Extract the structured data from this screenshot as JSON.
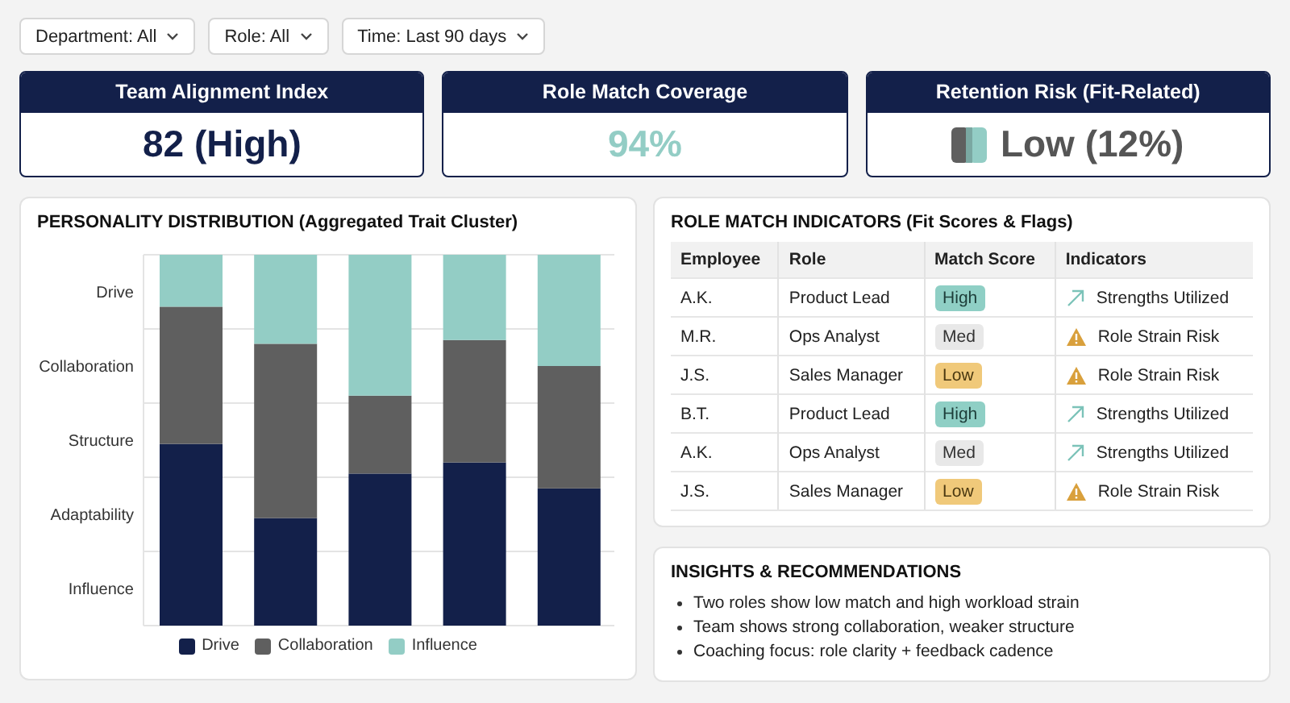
{
  "filters": [
    {
      "label": "Department: All"
    },
    {
      "label": "Role: All"
    },
    {
      "label": "Time: Last 90 days"
    }
  ],
  "kpis": [
    {
      "kind": "index",
      "title": "Team Alignment Index",
      "value": "82 (High)"
    },
    {
      "kind": "coverage",
      "title": "Role Match Coverage",
      "value": "94%"
    },
    {
      "kind": "risk",
      "title": "Retention Risk (Fit-Related)",
      "value": "Low (12%)"
    }
  ],
  "personality": {
    "title": "PERSONALITY DISTRIBUTION (Aggregated Trait Cluster)",
    "y_labels": [
      "Drive",
      "Collaboration",
      "Structure",
      "Adaptability",
      "Influence"
    ],
    "legend": [
      {
        "label": "Drive",
        "color": "#13204a"
      },
      {
        "label": "Collaboration",
        "color": "#5f5f5f"
      },
      {
        "label": "Influence",
        "color": "#93cdc5"
      }
    ]
  },
  "role_match": {
    "title": "ROLE MATCH INDICATORS (Fit Scores & Flags)",
    "columns": [
      "Employee",
      "Role",
      "Match Score",
      "Indicators"
    ],
    "rows": [
      {
        "employee": "A.K.",
        "role": "Product Lead",
        "score": {
          "label": "High",
          "kind": "high"
        },
        "indicator": {
          "label": "Strengths Utilized",
          "kind": "strength"
        }
      },
      {
        "employee": "M.R.",
        "role": "Ops Analyst",
        "score": {
          "label": "Med",
          "kind": "med"
        },
        "indicator": {
          "label": "Role Strain Risk",
          "kind": "risk"
        }
      },
      {
        "employee": "J.S.",
        "role": "Sales Manager",
        "score": {
          "label": "Low",
          "kind": "low"
        },
        "indicator": {
          "label": "Role Strain Risk",
          "kind": "risk"
        }
      },
      {
        "employee": "B.T.",
        "role": "Product Lead",
        "score": {
          "label": "High",
          "kind": "high"
        },
        "indicator": {
          "label": "Strengths Utilized",
          "kind": "strength"
        }
      },
      {
        "employee": "A.K.",
        "role": "Ops Analyst",
        "score": {
          "label": "Med",
          "kind": "med"
        },
        "indicator": {
          "label": "Strengths Utilized",
          "kind": "strength"
        }
      },
      {
        "employee": "J.S.",
        "role": "Sales Manager",
        "score": {
          "label": "Low",
          "kind": "low"
        },
        "indicator": {
          "label": "Role Strain Risk",
          "kind": "risk"
        }
      }
    ]
  },
  "insights": {
    "title": "INSIGHTS & RECOMMENDATIONS",
    "items": [
      "Two roles show low match and high workload strain",
      "Team shows strong collaboration, weaker structure",
      "Coaching focus: role clarity + feedback cadence"
    ]
  }
}
